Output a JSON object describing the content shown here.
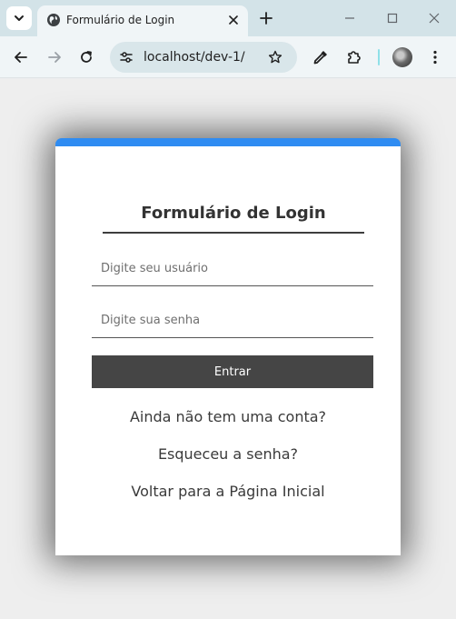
{
  "browser": {
    "tab_title": "Formulário de Login",
    "url": "localhost/dev-1/"
  },
  "login": {
    "title": "Formulário de Login",
    "username_placeholder": "Digite seu usuário",
    "password_placeholder": "Digite sua senha",
    "submit_label": "Entrar",
    "links": {
      "signup": "Ainda não tem uma conta?",
      "forgot": "Esqueceu a senha?",
      "home": "Voltar para a Página Inicial"
    }
  },
  "colors": {
    "accent": "#2f8cf2",
    "button": "#454545",
    "card": "#ffffff"
  }
}
